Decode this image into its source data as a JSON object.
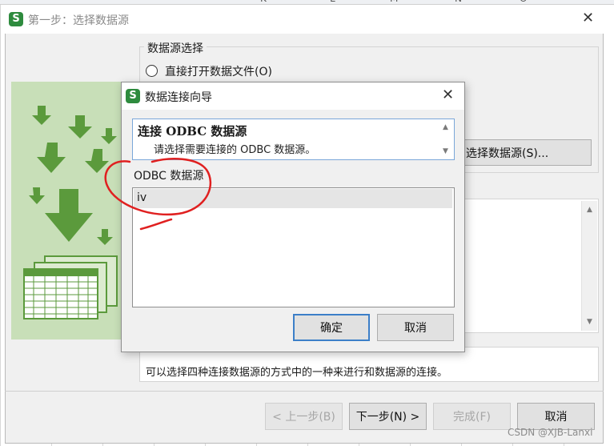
{
  "spreadsheet": {
    "column_letters": [
      "K",
      "L",
      "M",
      "N",
      "O"
    ]
  },
  "wizard": {
    "title": "第一步：选择数据源",
    "app_logo_letter": "S",
    "source_group_label": "数据源选择",
    "radio_open_file": "直接打开数据文件(O)",
    "select_source_button": "选择数据源(S)...",
    "hint_text": "可以选择四种连接数据源的方式中的一种来进行和数据源的连接。",
    "buttons": {
      "prev": "< 上一步(B)",
      "next": "下一步(N) >",
      "finish": "完成(F)",
      "cancel": "取消"
    }
  },
  "dialog": {
    "title": "数据连接向导",
    "app_logo_letter": "S",
    "header_title": "连接 ODBC 数据源",
    "header_subtitle": "请选择需要连接的 ODBC 数据源。",
    "list_label": "ODBC 数据源",
    "list_items": [
      "iv"
    ],
    "ok_button": "确定",
    "cancel_button": "取消"
  },
  "watermark": "CSDN @XJB-Lanxi",
  "colors": {
    "logo_green": "#2e8b3e",
    "illustration_green": "#5b9a3c",
    "illustration_bg": "#c8dfb8",
    "annotation_red": "#e02020",
    "focus_blue": "#3c7fc8"
  }
}
